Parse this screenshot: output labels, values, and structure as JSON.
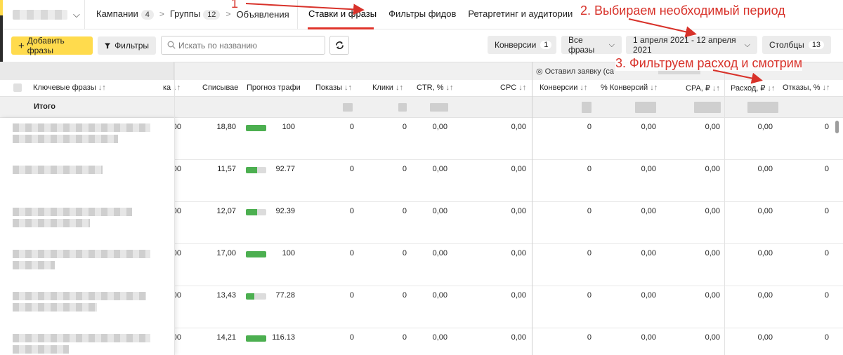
{
  "nav": {
    "breadcrumbs": [
      {
        "label": "Кампании",
        "count": "4"
      },
      {
        "label": "Группы",
        "count": "12"
      },
      {
        "label": "Объявления",
        "count": ""
      }
    ],
    "tabs": [
      "Ставки и фразы",
      "Фильтры фидов",
      "Ретаргетинг и аудитории"
    ]
  },
  "toolbar": {
    "add_label": "Добавить фразы",
    "filter_label": "Фильтры",
    "search_placeholder": "Искать по названию",
    "conversions_label": "Конверсии",
    "conversions_count": "1",
    "phrases_label": "Все фразы",
    "period_label": "1 апреля 2021 - 12 апреля 2021",
    "columns_label": "Столбцы",
    "columns_count": "13"
  },
  "table": {
    "group_label": "Оставил заявку (са",
    "headers": {
      "keyword": "Ключевые фразы",
      "bid": "ка",
      "charge": "Списывае",
      "forecast": "Прогноз трафи",
      "impressions": "Показы",
      "clicks": "Клики",
      "ctr": "CTR, %",
      "cpc": "CPC",
      "conversions": "Конверсии",
      "conv_pct": "% Конверсий",
      "cpa": "CPA, ₽",
      "spend": "Расход, ₽",
      "bounce": "Отказы, %"
    },
    "total_label": "Итого",
    "rows": [
      {
        "bid": "00",
        "charge": "18,80",
        "forecast": "100",
        "forecast_pct": 1.0,
        "impressions": "0",
        "clicks": "0",
        "ctr": "0,00",
        "cpc": "0,00",
        "conversions": "0",
        "conv_pct": "0,00",
        "cpa": "0,00",
        "spend": "0,00",
        "bounce": "0"
      },
      {
        "bid": "00",
        "charge": "11,57",
        "forecast": "92.77",
        "forecast_pct": 0.55,
        "impressions": "0",
        "clicks": "0",
        "ctr": "0,00",
        "cpc": "0,00",
        "conversions": "0",
        "conv_pct": "0,00",
        "cpa": "0,00",
        "spend": "0,00",
        "bounce": "0"
      },
      {
        "bid": "00",
        "charge": "12,07",
        "forecast": "92.39",
        "forecast_pct": 0.55,
        "impressions": "0",
        "clicks": "0",
        "ctr": "0,00",
        "cpc": "0,00",
        "conversions": "0",
        "conv_pct": "0,00",
        "cpa": "0,00",
        "spend": "0,00",
        "bounce": "0"
      },
      {
        "bid": "00",
        "charge": "17,00",
        "forecast": "100",
        "forecast_pct": 1.0,
        "impressions": "0",
        "clicks": "0",
        "ctr": "0,00",
        "cpc": "0,00",
        "conversions": "0",
        "conv_pct": "0,00",
        "cpa": "0,00",
        "spend": "0,00",
        "bounce": "0"
      },
      {
        "bid": "00",
        "charge": "13,43",
        "forecast": "77.28",
        "forecast_pct": 0.4,
        "impressions": "0",
        "clicks": "0",
        "ctr": "0,00",
        "cpc": "0,00",
        "conversions": "0",
        "conv_pct": "0,00",
        "cpa": "0,00",
        "spend": "0,00",
        "bounce": "0"
      },
      {
        "bid": "00",
        "charge": "14,21",
        "forecast": "116.13",
        "forecast_pct": 1.0,
        "impressions": "0",
        "clicks": "0",
        "ctr": "0,00",
        "cpc": "0,00",
        "conversions": "0",
        "conv_pct": "0,00",
        "cpa": "0,00",
        "spend": "0,00",
        "bounce": "0"
      }
    ]
  },
  "annotations": {
    "step1": "1",
    "step2": "2. Выбираем необходимый период",
    "step3": "3. Фильтруем расход и смотрим"
  },
  "colors": {
    "accent_yellow": "#ffdb4d",
    "tab_underline": "#e0342b",
    "annotation_red": "#d8322a",
    "bar_green": "#4caf50"
  }
}
